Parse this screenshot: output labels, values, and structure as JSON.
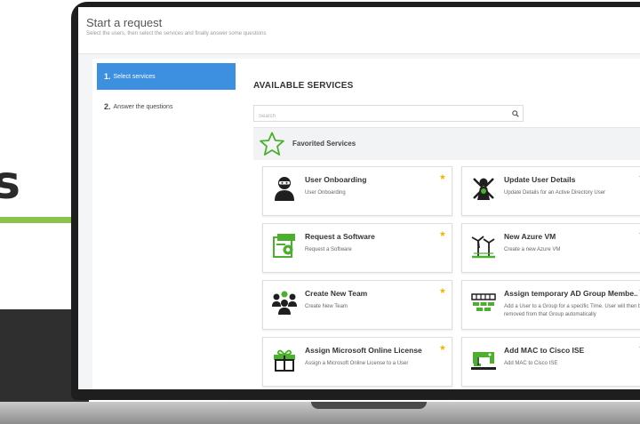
{
  "backdrop": {
    "partial_letter": "s"
  },
  "page": {
    "title": "Start a request",
    "subtitle": "Select the users, then select the services and finally answer some questions"
  },
  "steps": [
    {
      "number": "1.",
      "label": "Select services",
      "active": true
    },
    {
      "number": "2.",
      "label": "Answer the questions",
      "active": false
    }
  ],
  "main": {
    "section_title": "AVAILABLE SERVICES",
    "search_placeholder": "Search",
    "favorites_label": "Favorited Services"
  },
  "colors": {
    "accent_blue": "#3d8fe0",
    "icon_green": "#4caf2e",
    "star_yellow": "#f2b705"
  },
  "services": [
    {
      "name": "User Onboarding",
      "desc": "User Onboarding",
      "icon": "ninja-user-icon"
    },
    {
      "name": "Update User Details",
      "desc": "Update Details for an Active Directory User",
      "icon": "user-update-icon"
    },
    {
      "name": "Request a Software",
      "desc": "Request a Software",
      "icon": "software-request-icon"
    },
    {
      "name": "New Azure VM",
      "desc": "Create a new Azure VM",
      "icon": "azure-vm-icon"
    },
    {
      "name": "Create New Team",
      "desc": "Create New Team",
      "icon": "team-icon"
    },
    {
      "name": "Assign temporary AD Group Membe...",
      "desc": "Add a User to a Group for a specific Time. User will then be removed from that Group automatically",
      "icon": "ad-group-icon"
    },
    {
      "name": "Assign Microsoft Online License",
      "desc": "Assign a Microsoft Online License to a User",
      "icon": "gift-license-icon"
    },
    {
      "name": "Add MAC to Cisco ISE",
      "desc": "Add MAC to Cisco ISE",
      "icon": "sewing-machine-icon"
    }
  ]
}
